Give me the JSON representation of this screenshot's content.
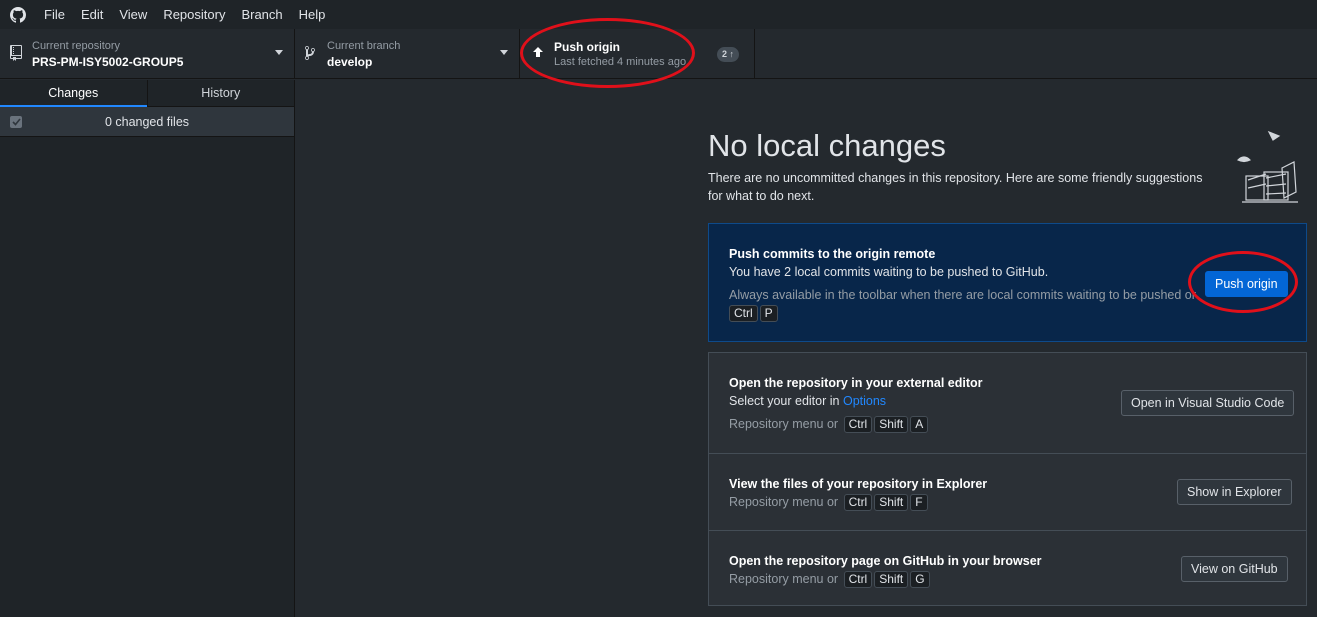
{
  "menubar": {
    "logo_icon": "github-icon",
    "items": [
      "File",
      "Edit",
      "View",
      "Repository",
      "Branch",
      "Help"
    ]
  },
  "toolbar": {
    "repo": {
      "label": "Current repository",
      "value": "PRS-PM-ISY5002-GROUP5",
      "icon": "repo-icon"
    },
    "branch": {
      "label": "Current branch",
      "value": "develop",
      "icon": "git-branch-icon"
    },
    "push": {
      "title": "Push origin",
      "subtitle": "Last fetched 4 minutes ago",
      "badge": "2",
      "icon": "arrow-up-icon"
    }
  },
  "sidebar": {
    "tabs": [
      "Changes",
      "History"
    ],
    "changed_files": "0 changed files"
  },
  "main": {
    "title": "No local changes",
    "description": "There are no uncommitted changes in this repository. Here are some friendly suggestions for what to do next.",
    "push_card": {
      "title": "Push commits to the origin remote",
      "text": "You have 2 local commits waiting to be pushed to GitHub.",
      "hint": "Always available in the toolbar when there are local commits waiting to be pushed or",
      "keys": [
        "Ctrl",
        "P"
      ],
      "button": "Push origin"
    },
    "editor_card": {
      "title": "Open the repository in your external editor",
      "text_prefix": "Select your editor in",
      "link": "Options",
      "hint": "Repository menu or",
      "keys": [
        "Ctrl",
        "Shift",
        "A"
      ],
      "button": "Open in Visual Studio Code"
    },
    "explorer_card": {
      "title": "View the files of your repository in Explorer",
      "hint": "Repository menu or",
      "keys": [
        "Ctrl",
        "Shift",
        "F"
      ],
      "button": "Show in Explorer"
    },
    "github_card": {
      "title": "Open the repository page on GitHub in your browser",
      "hint": "Repository menu or",
      "keys": [
        "Ctrl",
        "Shift",
        "G"
      ],
      "button": "View on GitHub"
    }
  },
  "colors": {
    "accent": "#0366d6",
    "annotation": "#e0101a"
  }
}
